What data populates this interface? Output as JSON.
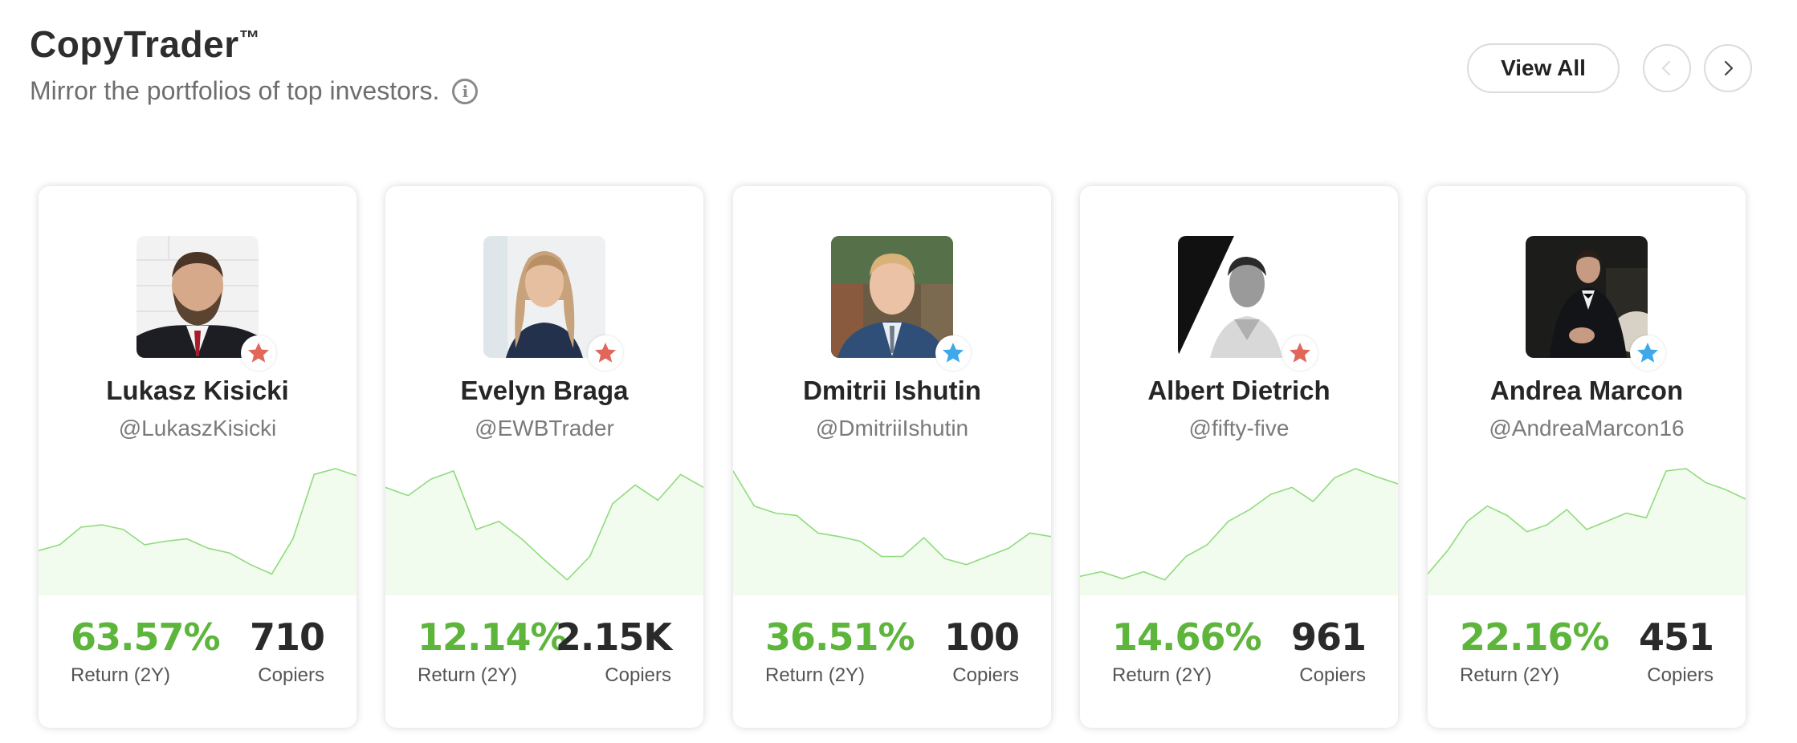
{
  "header": {
    "title": "CopyTrader",
    "title_mark": "™",
    "subtitle": "Mirror the portfolios of top investors.",
    "view_all_label": "View All"
  },
  "labels": {
    "return": "Return (2Y)",
    "copiers": "Copiers"
  },
  "colors": {
    "positive": "#5db53b",
    "star_red": "#e0675a",
    "star_blue": "#3ea8ea",
    "spark_line": "#8fdc7c",
    "spark_fill": "#f1fbee"
  },
  "traders": [
    {
      "name": "Lukasz Kisicki",
      "handle": "@LukaszKisicki",
      "return": "63.57%",
      "copiers": "710",
      "star": "red",
      "avatar": "bearded-man-suit",
      "trend": [
        30,
        35,
        50,
        52,
        48,
        35,
        38,
        40,
        32,
        28,
        18,
        10,
        40,
        95,
        100,
        94
      ]
    },
    {
      "name": "Evelyn Braga",
      "handle": "@EWBTrader",
      "return": "12.14%",
      "copiers": "2.15K",
      "star": "red",
      "avatar": "woman-long-hair",
      "trend": [
        84,
        77,
        91,
        98,
        48,
        55,
        40,
        22,
        5,
        25,
        70,
        86,
        73,
        95,
        84
      ]
    },
    {
      "name": "Dmitrii Ishutin",
      "handle": "@DmitriiIshutin",
      "return": "36.51%",
      "copiers": "100",
      "star": "blue",
      "avatar": "young-man-suit",
      "trend": [
        98,
        68,
        62,
        60,
        45,
        42,
        38,
        25,
        25,
        41,
        23,
        18,
        25,
        32,
        45,
        42
      ]
    },
    {
      "name": "Albert Dietrich",
      "handle": "@fifty-five",
      "return": "14.66%",
      "copiers": "961",
      "star": "red",
      "avatar": "man-bw-portrait",
      "trend": [
        8,
        12,
        6,
        12,
        5,
        25,
        35,
        55,
        65,
        78,
        84,
        72,
        92,
        100,
        93,
        87
      ]
    },
    {
      "name": "Andrea Marcon",
      "handle": "@AndreaMarcon16",
      "return": "22.16%",
      "copiers": "451",
      "star": "blue",
      "avatar": "man-seated-tuxedo",
      "trend": [
        10,
        30,
        55,
        68,
        60,
        46,
        52,
        65,
        48,
        55,
        62,
        58,
        98,
        100,
        88,
        82,
        74
      ]
    }
  ]
}
